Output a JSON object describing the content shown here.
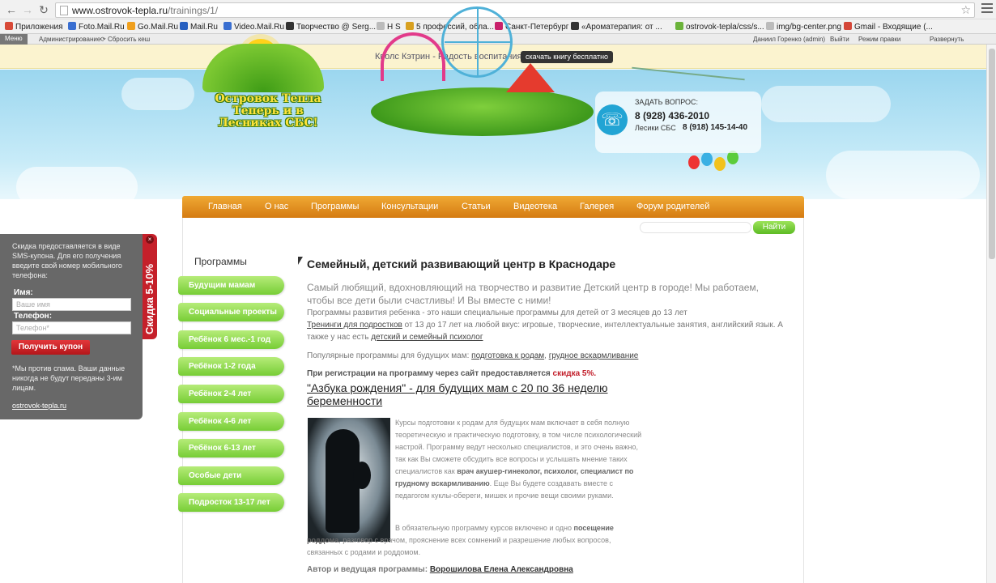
{
  "browser": {
    "url_domain": "www.ostrovok-tepla.ru",
    "url_path": "/trainings/1/"
  },
  "bookmarks": [
    {
      "label": "Приложения",
      "color": "#d84a38"
    },
    {
      "label": "Foto.Mail.Ru",
      "color": "#3a6fd1"
    },
    {
      "label": "Go.Mail.Ru",
      "color": "#f0a01e"
    },
    {
      "label": "Mail.Ru",
      "color": "#2860c0"
    },
    {
      "label": "Video.Mail.Ru",
      "color": "#3a6fd1"
    },
    {
      "label": "Творчество @ Serg...",
      "color": "#333333"
    },
    {
      "label": "H S",
      "color": "#bbbbbb"
    },
    {
      "label": "5 профессий, обла...",
      "color": "#d8a020"
    },
    {
      "label": "Санкт-Петербург",
      "color": "#c8206a"
    },
    {
      "label": "«Ароматерапия: от ...",
      "color": "#333333"
    },
    {
      "label": "ostrovok-tepla/css/s...",
      "color": "#6bb33a"
    },
    {
      "label": "img/bg-center.png",
      "color": "#bbbbbb"
    },
    {
      "label": "Gmail - Входящие (...",
      "color": "#d44638"
    }
  ],
  "admin_bar": {
    "menu": "Меню",
    "admin": "Администрирование",
    "cache": "Сбросить кеш",
    "user": "Даниил Горенко (admin)",
    "logout": "Выйти",
    "edit_mode": "Режим правки",
    "expand": "Развернуть"
  },
  "promo": {
    "text": "Кволс Кэтрин - Радость воспитания.",
    "button": "скачать книгу бесплатно"
  },
  "logo": {
    "line1": "Островок Тепла",
    "line2": "Теперь и в Лесниках СБС!"
  },
  "contact": {
    "ask_label": "ЗАДАТЬ ВОПРОС:",
    "phone_main": "8 (928) 436-2010",
    "phone_sub_label": "Лесики СБС",
    "phone_sub": "8 (918) 145-14-40"
  },
  "nav": [
    "Главная",
    "О нас",
    "Программы",
    "Консультации",
    "Статьи",
    "Видеотека",
    "Галерея",
    "Форум родителей"
  ],
  "search": {
    "button": "Найти",
    "placeholder": ""
  },
  "sidebar": {
    "title": "Программы",
    "items": [
      "Будущим мамам",
      "Социальные проекты",
      "Ребёнок 6 мес.-1 год",
      "Ребёнок 1-2 года",
      "Ребёнок 2-4 лет",
      "Ребёнок 4-6 лет",
      "Ребёнок 6-13 лет",
      "Особые дети",
      "Подросток 13-17 лет"
    ]
  },
  "article": {
    "title": "Семейный, детский развивающий центр в Краснодаре",
    "lead": "Самый любящий, вдохновляющий на творчество и развитие Детский центр в городе! Мы работаем, чтобы все дети были счастливы! И Вы вместе с ними!",
    "p1": "Программы развития ребенка - это наши специальные программы для детей от 3 месяцев до 13 лет",
    "p2_link": "Тренинги для подростков",
    "p2_text": " от 13 до 17 лет на любой вкус: игровые, творческие, интеллектуальные занятия, английский язык. А также у нас есть ",
    "p2_link2": "детский и семейный психолог",
    "p3_text": "Популярные программы для будущих мам: ",
    "p3_link1": "подготовка к родам",
    "p3_sep": ", ",
    "p3_link2": "грудное вскармливание",
    "promo_text": "При регистрации на программу через сайт предоставляется ",
    "promo_discount": "скидка 5%.",
    "course_title": "\"Азбука рождения\" - для будущих мам с 20 по 36 неделю беременности",
    "course_desc_1": "Курсы подготовки к родам для будущих мам включает в себя полную теоретическую и практическую подготовку, в том числе психологический настрой. Программу ведут несколько специалистов, и это очень важно, так как Вы сможете обсудить все вопросы и услышать мнение таких специалистов как ",
    "course_desc_bold": "врач акушер-гинеколог, психолог, специалист по грудному вскармливанию",
    "course_desc_2": ". Еще Вы будете создавать вместе с педагогом куклы-обереги, мишек и прочие вещи своими руками.",
    "course_more_1": "В обязательную программу курсов включено и одно ",
    "course_more_bold": "посещение роддома",
    "course_more_2": ", разговор с врачом, прояснение всех сомнений и разрешение любых вопросов, связанных с родами и роддомом.",
    "author_label": "Автор и ведущая программы: ",
    "author_name": "Ворошилова Елена Александровна"
  },
  "sms": {
    "desc": "Скидка предоставляется в виде SMS-купона. Для его получения введите свой номер мобильного телефона:",
    "name_label": "Имя:",
    "name_placeholder": "Ваше имя",
    "phone_label": "Телефон:",
    "phone_placeholder": "Телефон*",
    "button": "Получить купон",
    "note": "*Мы против спама. Ваши данные никогда не будут переданы 3-им лицам.",
    "link": "ostrovok-tepla.ru",
    "tab": "Скидка 5-10%"
  }
}
